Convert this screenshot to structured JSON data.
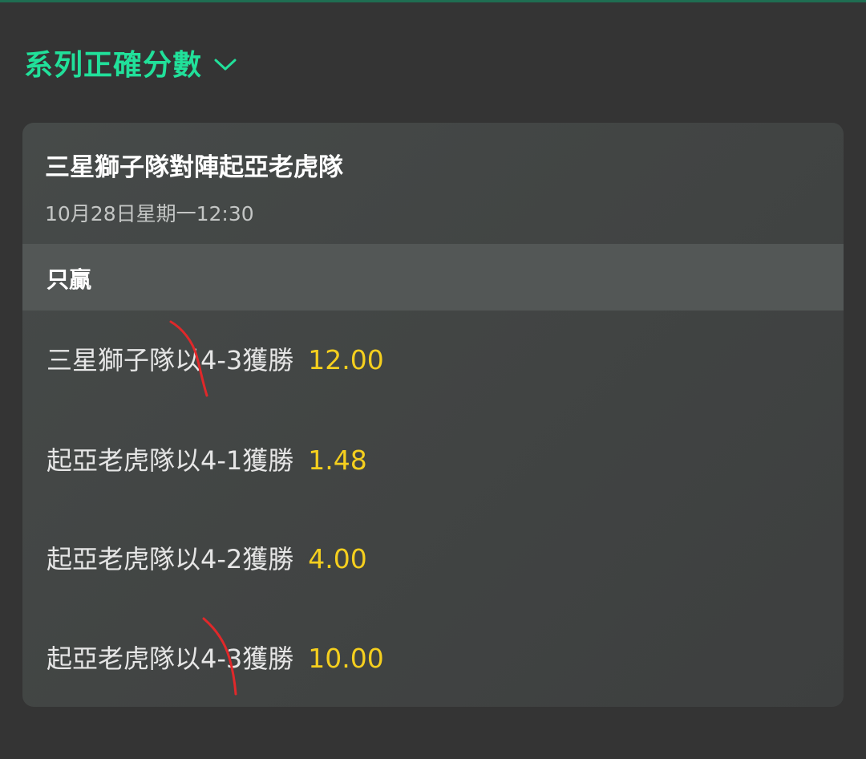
{
  "section": {
    "title": "系列正確分數",
    "toggle_icon": "chevron-down-icon",
    "accent_color": "#21e09a"
  },
  "match": {
    "title": "三星獅子隊對陣起亞老虎隊",
    "date": "10月28日星期一12:30"
  },
  "market": {
    "label": "只贏"
  },
  "outcomes": [
    {
      "label": "三星獅子隊以4-3獲勝",
      "odds": "12.00"
    },
    {
      "label": "起亞老虎隊以4-1獲勝",
      "odds": "1.48"
    },
    {
      "label": "起亞老虎隊以4-2獲勝",
      "odds": "4.00"
    },
    {
      "label": "起亞老虎隊以4-3獲勝",
      "odds": "10.00"
    }
  ],
  "colors": {
    "background": "#343434",
    "card": "#444746",
    "odds": "#f5cf1e",
    "annotation_mark": "#e0282a"
  }
}
